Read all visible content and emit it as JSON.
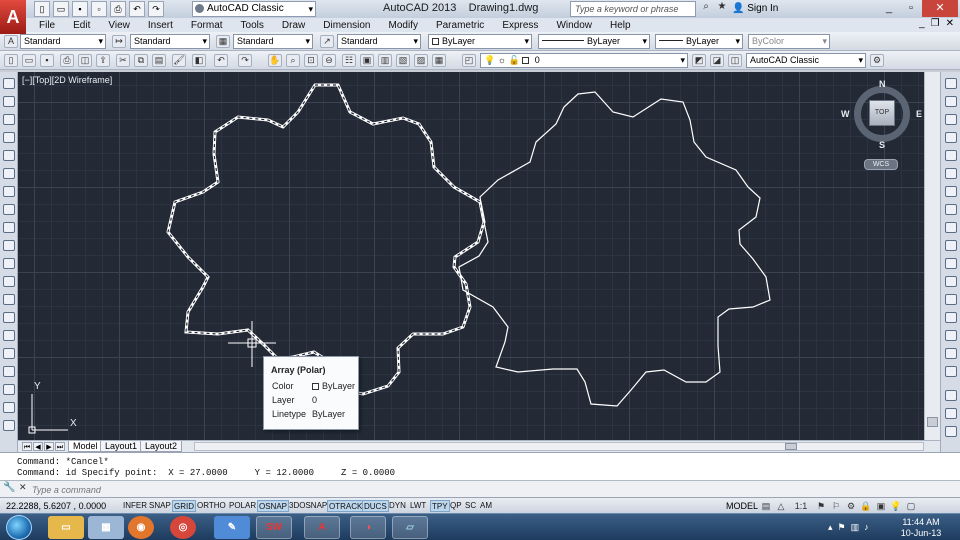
{
  "title_bar": {
    "workspace": "AutoCAD Classic",
    "app_name": "AutoCAD 2013",
    "document": "Drawing1.dwg",
    "search_placeholder": "Type a keyword or phrase",
    "sign_in": "Sign In"
  },
  "menu": [
    "File",
    "Edit",
    "View",
    "Insert",
    "Format",
    "Tools",
    "Draw",
    "Dimension",
    "Modify",
    "Parametric",
    "Express",
    "Window",
    "Help"
  ],
  "styles_toolbar": {
    "text_style": "Standard",
    "dim_style": "Standard",
    "table_style": "Standard",
    "multileader_style": "Standard",
    "color": "ByLayer",
    "linetype": "ByLayer",
    "lineweight": "ByLayer",
    "plot_style": "ByColor"
  },
  "layers_toolbar": {
    "current_layer": "0",
    "workspace": "AutoCAD Classic"
  },
  "viewport": {
    "label": "[−][Top][2D Wireframe]",
    "viewcube": {
      "n": "N",
      "s": "S",
      "e": "E",
      "w": "W",
      "face": "TOP"
    },
    "wcs": "WCS",
    "ucs": {
      "x": "X",
      "y": "Y"
    }
  },
  "tooltip": {
    "title": "Array (Polar)",
    "rows": [
      {
        "label": "Color",
        "value": "ByLayer"
      },
      {
        "label": "Layer",
        "value": "0"
      },
      {
        "label": "Linetype",
        "value": "ByLayer"
      }
    ]
  },
  "layout_tabs": [
    "Model",
    "Layout1",
    "Layout2"
  ],
  "command_history": [
    "Command: *Cancel*",
    "Command: id Specify point:  X = 27.0000     Y = 12.0000     Z = 0.0000"
  ],
  "command_prompt_placeholder": "Type a command",
  "status_bar": {
    "coordinates": "22.2288, 5.6207 , 0.0000",
    "toggles": [
      {
        "label": "INFER",
        "on": false
      },
      {
        "label": "SNAP",
        "on": false
      },
      {
        "label": "GRID",
        "on": true
      },
      {
        "label": "ORTHO",
        "on": false
      },
      {
        "label": "POLAR",
        "on": false
      },
      {
        "label": "OSNAP",
        "on": true
      },
      {
        "label": "3DOSNAP",
        "on": false
      },
      {
        "label": "OTRACK",
        "on": true
      },
      {
        "label": "DUCS",
        "on": true
      },
      {
        "label": "DYN",
        "on": false
      },
      {
        "label": "LWT",
        "on": false
      },
      {
        "label": "TPY",
        "on": true
      },
      {
        "label": "QP",
        "on": false
      },
      {
        "label": "SC",
        "on": false
      },
      {
        "label": "AM",
        "on": false
      }
    ],
    "model": "MODEL",
    "annotation_scale": "1:1"
  },
  "taskbar": {
    "apps": [
      "explorer-icon",
      "calculator-icon",
      "firefox-icon",
      "chrome-icon",
      "paint-icon",
      "solidworks-icon",
      "autocad-icon",
      "media-icon",
      "notepad-icon"
    ],
    "time": "11:44 AM",
    "date": "10-Jun-13"
  },
  "colors": {
    "canvas": "#232a36",
    "grid_major": "#3a4453",
    "gear": "#ffffff",
    "accent": "#bcd6ee"
  }
}
